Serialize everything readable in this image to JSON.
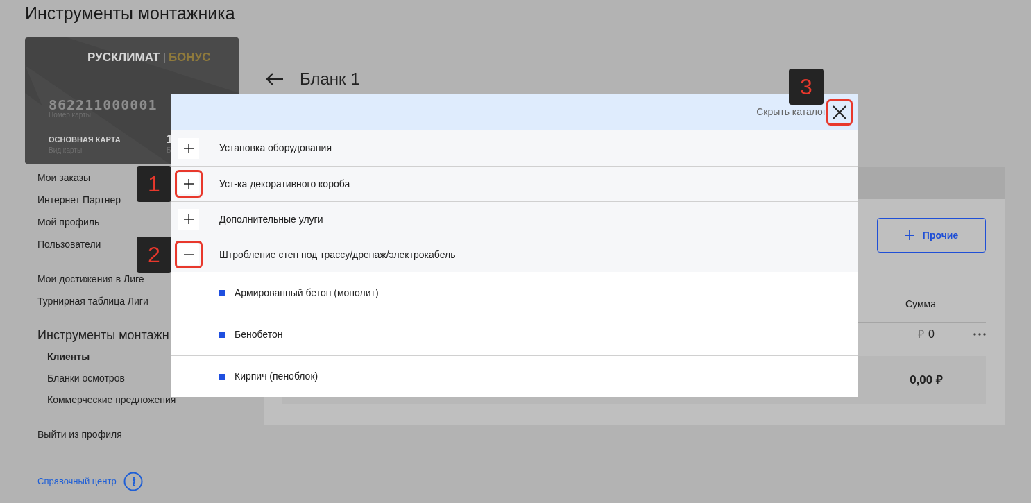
{
  "page": {
    "title": "Инструменты монтажника"
  },
  "card": {
    "brand": "РУСКЛИМАТ",
    "separator": "|",
    "brand_suffix": "БОНУС",
    "number": "862211000001",
    "number_label": "Номер карты",
    "type": "ОСНОВНАЯ КАРТА",
    "type_label": "Вид карты",
    "balance": "1",
    "balance_label": "Б"
  },
  "sidebar": {
    "groups": [
      {
        "items": [
          {
            "label": "Мои заказы"
          },
          {
            "label": "Интернет Партнер"
          },
          {
            "label": "Мой профиль"
          },
          {
            "label": "Пользователи"
          }
        ]
      },
      {
        "items": [
          {
            "label": "Мои достижения в Лиге"
          },
          {
            "label": "Турнирная таблица Лиги"
          }
        ]
      }
    ],
    "section": {
      "title": "Инструменты монтажн",
      "items": [
        {
          "label": "Клиенты",
          "selected": true
        },
        {
          "label": "Бланки осмотров",
          "selected": false
        },
        {
          "label": "Коммерческие предложения",
          "selected": false
        }
      ]
    },
    "logout": "Выйти из профиля",
    "help": "Справочный центр"
  },
  "main": {
    "title": "Бланк 1",
    "button": "Прочие",
    "column": "Сумма",
    "row": {
      "currency": "₽",
      "amount": "0"
    },
    "total": "0,00 ₽"
  },
  "modal": {
    "hide_label": "Скрыть каталог",
    "close_marker": "3",
    "categories": [
      {
        "label": "Установка оборудования",
        "expanded": false
      },
      {
        "label": "Уст-ка декоративного короба",
        "expanded": false,
        "marker": "1"
      },
      {
        "label": "Дополнительные улуги",
        "expanded": false
      },
      {
        "label": "Штробление стен под трассу/дренаж/электрокабель",
        "expanded": true,
        "marker": "2",
        "children": [
          {
            "label": "Армированный бетон (монолит)"
          },
          {
            "label": "Бенобетон"
          },
          {
            "label": "Кирпич (пеноблок)"
          }
        ]
      }
    ]
  }
}
